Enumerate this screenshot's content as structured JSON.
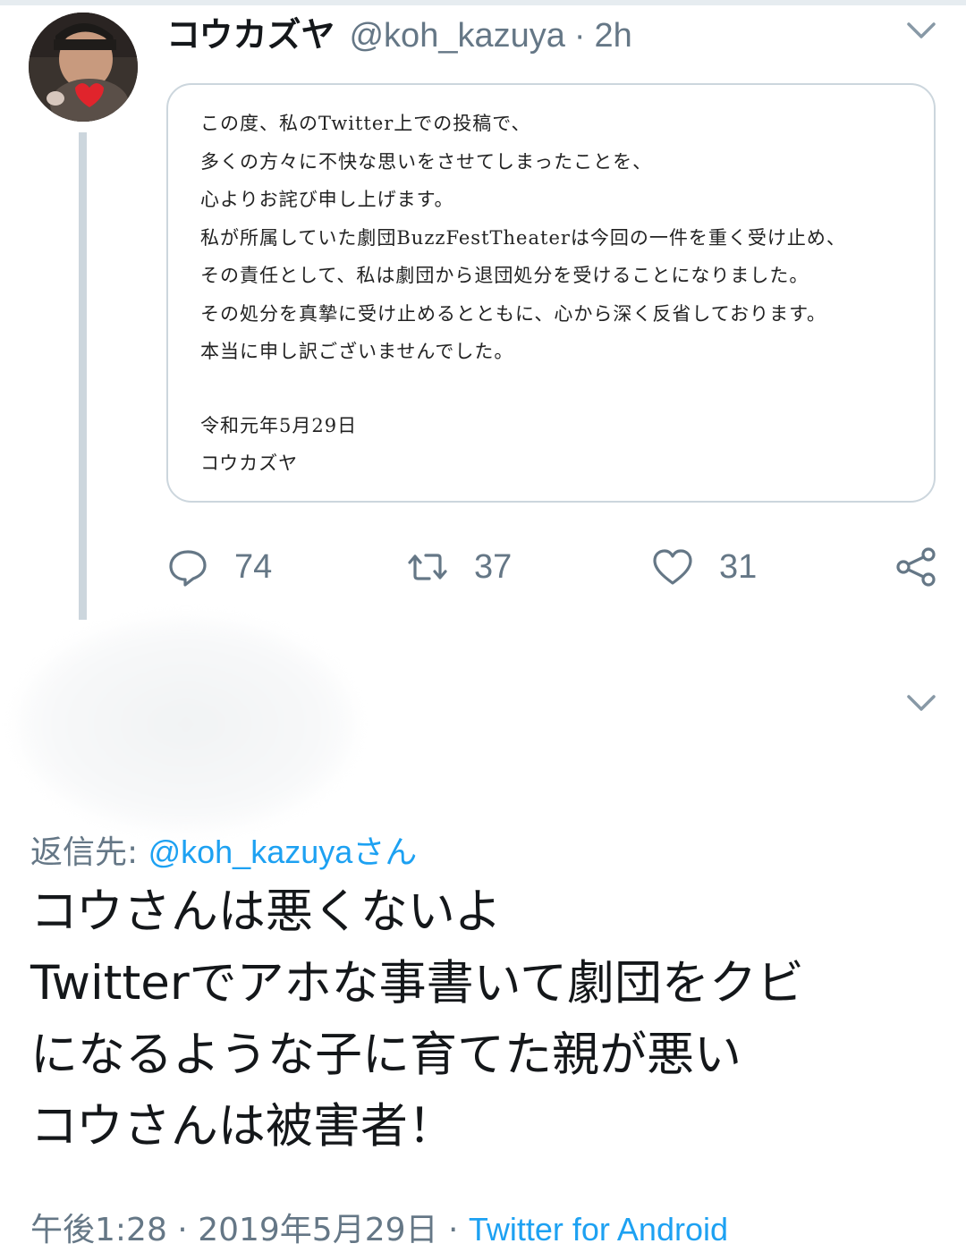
{
  "parent_tweet": {
    "display_name": "コウカズヤ",
    "handle": "@koh_kazuya",
    "separator": "·",
    "time": "2h",
    "statement_lines": [
      "この度、私のTwitter上での投稿で、",
      "多くの方々に不快な思いをさせてしまったことを、",
      "心よりお詫び申し上げます。",
      "私が所属していた劇団BuzzFestTheaterは今回の一件を重く受け止め、",
      "その責任として、私は劇団から退団処分を受けることになりました。",
      "その処分を真摯に受け止めるとともに、心から深く反省しております。",
      "本当に申し訳ございませんでした。"
    ],
    "statement_date": "令和元年5月29日",
    "statement_signature": "コウカズヤ",
    "actions": {
      "reply_count": "74",
      "retweet_count": "37",
      "like_count": "31"
    }
  },
  "reply_tweet": {
    "reply_to_prefix": "返信先: ",
    "reply_to_handle": "@koh_kazuya",
    "reply_to_suffix": "さん",
    "body_lines": [
      "コウさんは悪くないよ",
      "Twitterでアホな事書いて劇団をクビ",
      "になるような子に育てた親が悪い",
      "コウさんは被害者！"
    ],
    "time": "午後1:28",
    "separator": " · ",
    "date": "2019年5月29日",
    "source": "Twitter for Android"
  },
  "colors": {
    "accent": "#1da1f2",
    "muted": "#657786",
    "border": "#ccd6dd"
  },
  "icons": [
    "avatar",
    "chevron-down-icon",
    "reply-icon",
    "retweet-icon",
    "like-icon",
    "share-icon"
  ]
}
